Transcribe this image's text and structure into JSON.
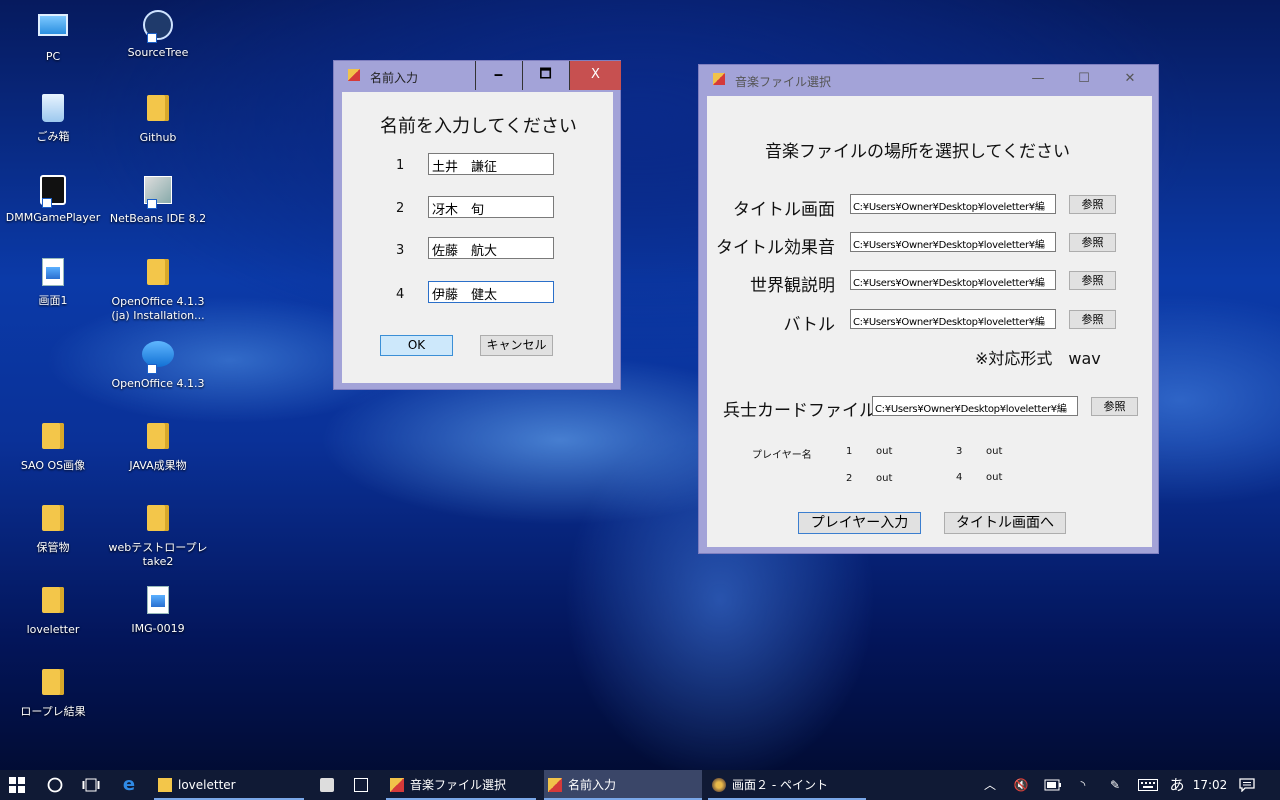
{
  "desktop": {
    "icons": [
      {
        "label": "PC",
        "icon": "pc-icon"
      },
      {
        "label": "SourceTree",
        "icon": "sourcetree-icon"
      },
      {
        "label": "ごみ箱",
        "icon": "recycle-bin-icon"
      },
      {
        "label": "Github",
        "icon": "folder-icon"
      },
      {
        "label": "DMMGamePlayer",
        "icon": "dmm-icon"
      },
      {
        "label": "NetBeans IDE 8.2",
        "icon": "netbeans-icon"
      },
      {
        "label": "画面1",
        "icon": "image-file-icon"
      },
      {
        "label": "OpenOffice 4.1.3 (ja) Installation...",
        "icon": "folder-icon"
      },
      {
        "label": "OpenOffice 4.1.3",
        "icon": "openoffice-icon"
      },
      {
        "label": "SAO OS画像",
        "icon": "folder-icon"
      },
      {
        "label": "JAVA成果物",
        "icon": "folder-icon"
      },
      {
        "label": "保管物",
        "icon": "folder-icon"
      },
      {
        "label": "webテストロープレ take2",
        "icon": "folder-icon"
      },
      {
        "label": "loveletter",
        "icon": "folder-icon"
      },
      {
        "label": "IMG-0019",
        "icon": "image-file-icon"
      },
      {
        "label": "ロープレ結果",
        "icon": "folder-icon"
      }
    ]
  },
  "name_dialog": {
    "title": "名前入力",
    "heading": "名前を入力してください",
    "rows": [
      {
        "num": "1",
        "value": "土井　謙征"
      },
      {
        "num": "2",
        "value": "冴木　旬"
      },
      {
        "num": "3",
        "value": "佐藤　航大"
      },
      {
        "num": "4",
        "value": "伊藤　健太"
      }
    ],
    "ok": "OK",
    "cancel": "キャンセル",
    "caption": {
      "minimize": "🗕",
      "maximize": "🗖",
      "close": "X"
    }
  },
  "music_dialog": {
    "title": "音楽ファイル選択",
    "heading": "音楽ファイルの場所を選択してください",
    "rows": [
      {
        "label": "タイトル画面",
        "path": "C:¥Users¥Owner¥Desktop¥loveletter¥編",
        "browse": "参照"
      },
      {
        "label": "タイトル効果音",
        "path": "C:¥Users¥Owner¥Desktop¥loveletter¥編",
        "browse": "参照"
      },
      {
        "label": "世界観説明",
        "path": "C:¥Users¥Owner¥Desktop¥loveletter¥編",
        "browse": "参照"
      },
      {
        "label": "バトル",
        "path": "C:¥Users¥Owner¥Desktop¥loveletter¥編",
        "browse": "参照"
      }
    ],
    "format_note": "※対応形式　wav",
    "soldier": {
      "label": "兵士カードファイル",
      "path": "C:¥Users¥Owner¥Desktop¥loveletter¥編",
      "browse": "参照"
    },
    "players": {
      "label": "プレイヤー名",
      "entries": [
        {
          "num": "1",
          "value": "out"
        },
        {
          "num": "3",
          "value": "out"
        },
        {
          "num": "2",
          "value": "out"
        },
        {
          "num": "4",
          "value": "out"
        }
      ]
    },
    "player_input_button": "プレイヤー入力",
    "to_title_button": "タイトル画面へ",
    "caption": {
      "minimize": "—",
      "maximize": "☐",
      "close": "✕"
    }
  },
  "taskbar": {
    "items": [
      {
        "label": "loveletter"
      },
      {
        "label": ""
      },
      {
        "label": ""
      },
      {
        "label": "音楽ファイル選択"
      },
      {
        "label": "名前入力"
      },
      {
        "label": "画面２ - ペイント"
      }
    ],
    "ime": "あ",
    "clock": "17:02"
  },
  "colors": {
    "window_frame": "#a3a3d8",
    "close_active": "#c75050",
    "taskbar": "#101a35"
  }
}
